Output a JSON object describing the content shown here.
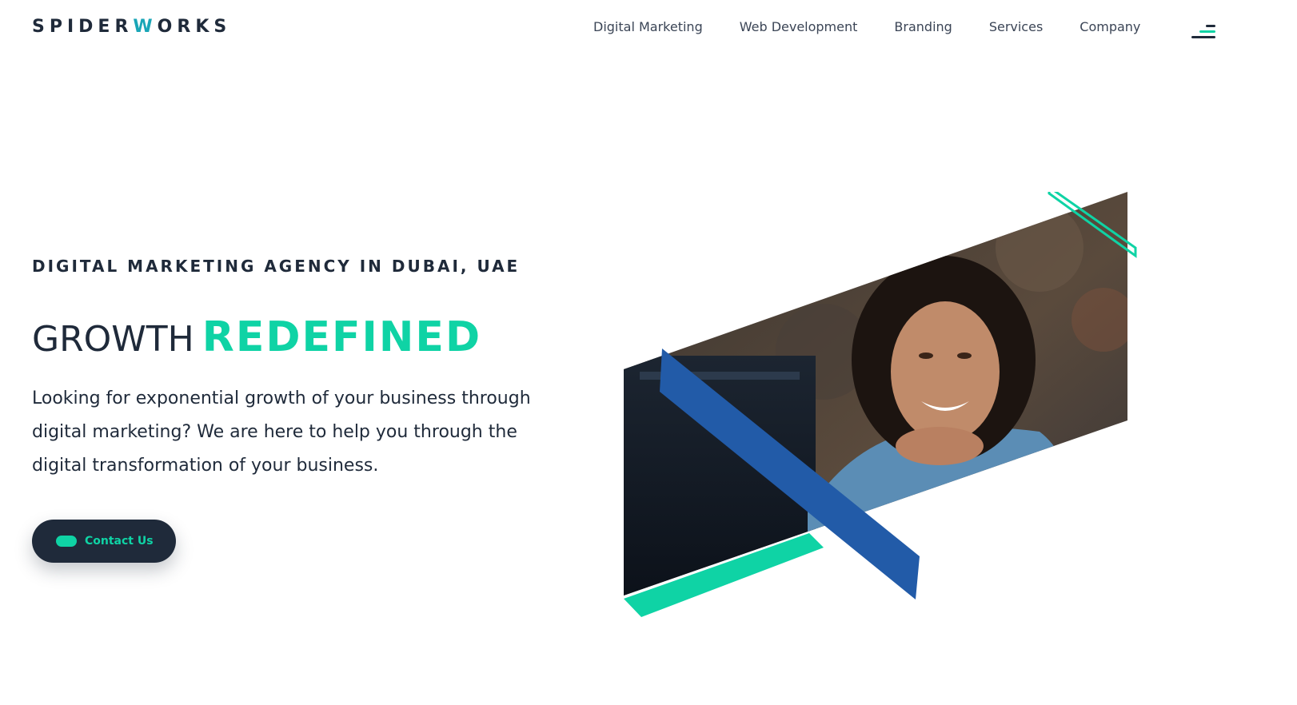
{
  "header": {
    "logo": {
      "part1": "SPIDER",
      "accent": "W",
      "part2": "ORKS"
    },
    "nav": [
      {
        "label": "Digital Marketing"
      },
      {
        "label": "Web Development"
      },
      {
        "label": "Branding"
      },
      {
        "label": "Services"
      },
      {
        "label": "Company"
      }
    ],
    "menu_icon": "hamburger-menu-icon"
  },
  "hero": {
    "eyebrow": "DIGITAL MARKETING AGENCY IN DUBAI, UAE",
    "headline": {
      "light": "GROWTH",
      "bold": "REDEFINED"
    },
    "intro_lines": [
      "Looking for exponential growth of your business through",
      "digital marketing? We are here to help you through the",
      "digital transformation of your business."
    ],
    "cta_label": "Contact Us"
  },
  "colors": {
    "navy": "#1f2a3a",
    "teal": "#0fd3a5",
    "logo_accent": "#1aa6b7",
    "blue_stripe": "#225ba8"
  }
}
